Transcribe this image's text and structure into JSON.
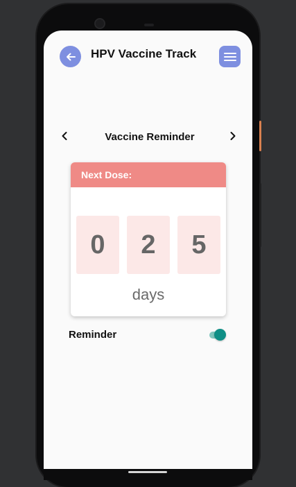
{
  "header": {
    "title": "HPV Vaccine Track",
    "back_icon": "arrow-left-icon",
    "menu_icon": "hamburger-menu-icon",
    "accent_color": "#7e8fe0"
  },
  "reminder_nav": {
    "title": "Vaccine Reminder",
    "prev_icon": "chevron-left-icon",
    "next_icon": "chevron-right-icon"
  },
  "countdown_card": {
    "header_label": "Next Dose:",
    "header_color": "#ef8a86",
    "digits": [
      "0",
      "2",
      "5"
    ],
    "unit": "days"
  },
  "reminder_setting": {
    "label": "Reminder",
    "enabled": true,
    "toggle_color": "#0f8f86"
  }
}
